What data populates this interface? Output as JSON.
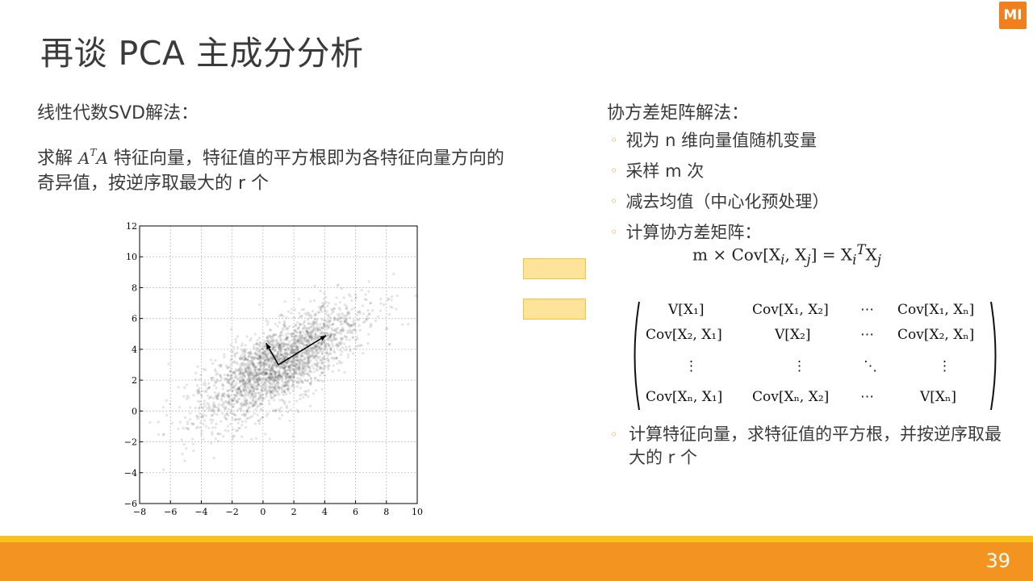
{
  "slide": {
    "title": "再谈 PCA 主成分分析",
    "logo_text": "MI",
    "page_number": "39",
    "colors": {
      "accent_orange": "#f39320",
      "accent_yellow": "#f7c21b",
      "logo": "#f07f1d",
      "equals_fill": "#fde49a"
    }
  },
  "left": {
    "heading": "线性代数SVD解法：",
    "desc_prefix": "求解 ",
    "desc_math_base": "A",
    "desc_math_sup": "T",
    "desc_math_tail": "A",
    "desc_suffix": " 特征向量，特征值的平方根即为各特征向量方向的奇异值，按逆序取最大的 r 个"
  },
  "right": {
    "heading": "协方差矩阵解法：",
    "bullets": [
      "视为 n 维向量值随机变量",
      "采样 m 次",
      "减去均值（中心化预处理）",
      "计算协方差矩阵："
    ],
    "formula": {
      "lhs": "m × Cov[X",
      "lhs_sub_i": "i",
      "mid": ", X",
      "lhs_sub_j": "j",
      "rhs_close": "] = X",
      "rhs_sub_i": "i",
      "rhs_sup": "T",
      "rhs_x2": "X",
      "rhs_sub_j": "j"
    },
    "matrix": [
      [
        "V[X₁]",
        "Cov[X₁, X₂]",
        "⋯",
        "Cov[X₁, Xₙ]"
      ],
      [
        "Cov[X₂, X₁]",
        "V[X₂]",
        "⋯",
        "Cov[X₂, Xₙ]"
      ],
      [
        "⋮",
        "⋮",
        "⋱",
        "⋮"
      ],
      [
        "Cov[Xₙ, X₁]",
        "Cov[Xₙ, X₂]",
        "⋯",
        "V[Xₙ]"
      ]
    ],
    "last_bullet": "计算特征向量，求特征值的平方根，并按逆序取最大的 r 个"
  },
  "chart_data": {
    "type": "scatter",
    "title": "",
    "xlabel": "",
    "ylabel": "",
    "xlim": [
      -8,
      10
    ],
    "ylim": [
      -6,
      12
    ],
    "x_ticks": [
      "−8",
      "−6",
      "−4",
      "−2",
      "0",
      "2",
      "4",
      "6",
      "8",
      "10"
    ],
    "y_ticks": [
      "−6",
      "−4",
      "−2",
      "0",
      "2",
      "4",
      "6",
      "8",
      "10",
      "12"
    ],
    "grid": true,
    "point_color": "#555555",
    "distribution": {
      "mean": [
        1,
        3
      ],
      "principal_angle_deg": 33,
      "major_sd": 3.0,
      "minor_sd": 1.1,
      "n_points": 2500
    },
    "arrows": [
      {
        "from": [
          1,
          3
        ],
        "to": [
          4.1,
          4.9
        ]
      },
      {
        "from": [
          1,
          3
        ],
        "to": [
          0.2,
          4.4
        ]
      }
    ]
  }
}
